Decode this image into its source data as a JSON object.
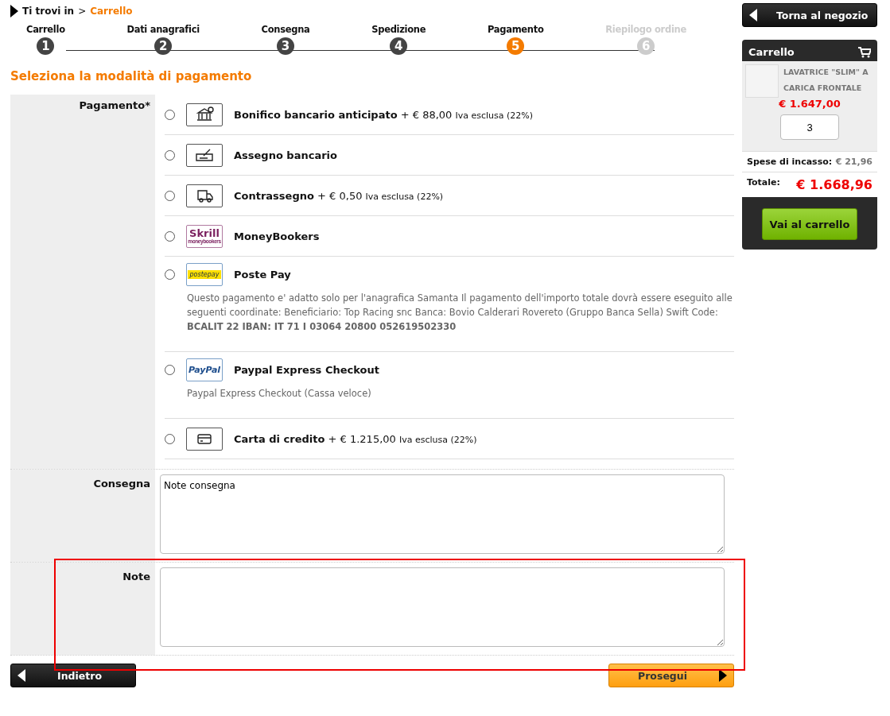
{
  "breadcrumb": {
    "prefix": "Ti trovi in",
    "separator": ">",
    "current": "Carrello"
  },
  "steps": [
    {
      "label": "Carrello",
      "number": "1",
      "selected": false,
      "disabled": false
    },
    {
      "label": "Dati anagrafici",
      "number": "2",
      "selected": false,
      "disabled": false
    },
    {
      "label": "Consegna",
      "number": "3",
      "selected": false,
      "disabled": false
    },
    {
      "label": "Spedizione",
      "number": "4",
      "selected": false,
      "disabled": false
    },
    {
      "label": "Pagamento",
      "number": "5",
      "selected": true,
      "disabled": false
    },
    {
      "label": "Riepilogo ordine",
      "number": "6",
      "selected": false,
      "disabled": true
    }
  ],
  "heading": "Seleziona la modalità di pagamento",
  "payment": {
    "label": "Pagamento*",
    "methods": [
      {
        "kind": "bank",
        "name": "Bonifico bancario anticipato",
        "price": "+ € 88,00",
        "tax": "Iva esclusa (22%)",
        "selected": false
      },
      {
        "kind": "check",
        "name": "Assegno bancario",
        "selected": false
      },
      {
        "kind": "truck",
        "name": "Contrassegno",
        "price": "+ € 0,50",
        "tax": "Iva esclusa (22%)",
        "selected": false
      },
      {
        "kind": "skrill",
        "logo_text": "Skrill",
        "logo_subtext": "moneybookers",
        "name": "MoneyBookers",
        "selected": false
      },
      {
        "kind": "postepay",
        "logo_text": "postepay",
        "name": "Poste Pay",
        "description": "Questo pagamento e' adatto solo per l'anagrafica Samanta Il pagamento dell'importo totale dovrà essere eseguito alle seguenti coordinate: Beneficiario: Top Racing snc Banca: Bovio Calderari Rovereto (Gruppo Banca Sella) Swift Code: **BCALIT 22 IBAN: IT 71 I 03064 20800 052619502330**",
        "selected": false
      },
      {
        "kind": "paypal",
        "logo_text": "PayPal",
        "name": "Paypal Express Checkout",
        "description": "Paypal Express Checkout (Cassa veloce)",
        "selected": false
      },
      {
        "kind": "card",
        "name": "Carta di credito",
        "price": "+ € 1.215,00",
        "tax": "Iva esclusa (22%)",
        "selected": false
      }
    ]
  },
  "notes_fields": [
    {
      "label": "Consegna",
      "value": "Note consegna",
      "highlighted": false
    },
    {
      "label": "Note",
      "highlighted": true
    }
  ],
  "buttons": {
    "back": "Indietro",
    "next": "Prosegui"
  },
  "sidebar": {
    "back_button": "Torna al negozio",
    "cart": {
      "title": "Carrello",
      "item": {
        "name": "LAVATRICE \"SLIM\" A CARICA FRONTALE",
        "price": "€ 1.647,00",
        "quantity": "3"
      },
      "fee_label": "Spese di incasso:",
      "fee_value": "€ 21,96",
      "total_label": "Totale:",
      "total_value": "€ 1.668,96",
      "cta": "Vai al carrello"
    }
  }
}
